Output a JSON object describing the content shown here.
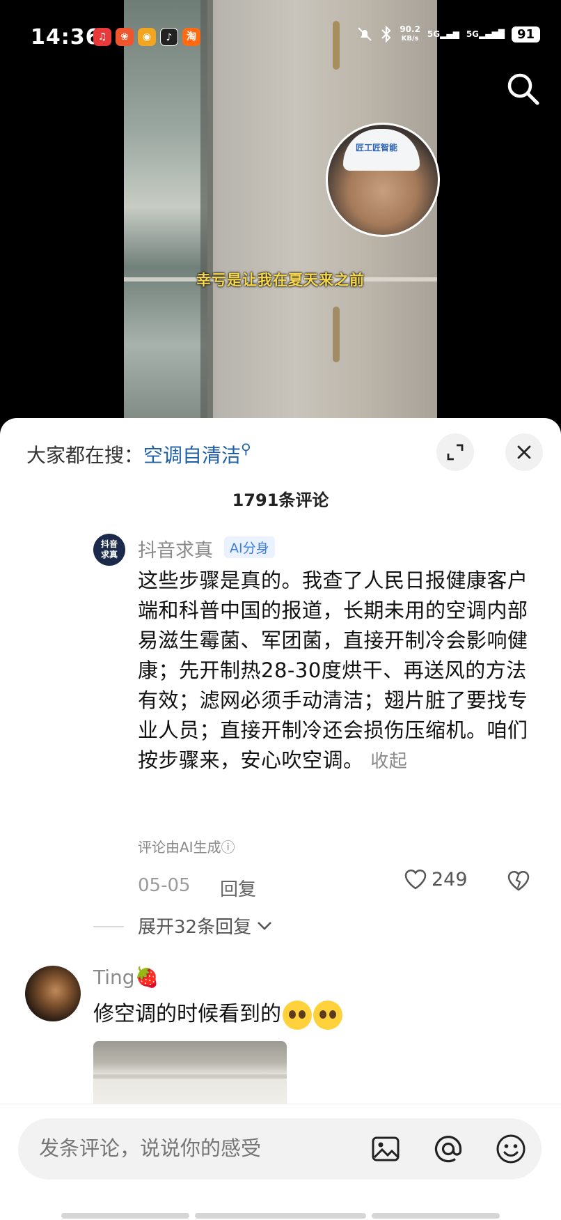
{
  "status_bar": {
    "time": "14:36",
    "network_speed": "90.2",
    "network_unit": "KB/s",
    "sig1": "5G",
    "sig2": "5G",
    "battery": "91"
  },
  "video": {
    "subtitle": "幸亏是让我在夏天来之前",
    "helmet_text": "匠工匠智能"
  },
  "header": {
    "hot_search_prefix": "大家都在搜：",
    "hot_search_keyword": "空调自清洁"
  },
  "comments_count": "1791条评论",
  "comments": [
    {
      "avatar_text": "抖音求真",
      "name": "抖音求真",
      "badge": "AI分身",
      "text": "这些步骤是真的。我查了人民日报健康客户端和科普中国的报道，长期未用的空调内部易滋生霉菌、军团菌，直接开制冷会影响健康；先开制热28-30度烘干、再送风的方法有效；滤网必须手动清洁；翅片脏了要找专业人员；直接开制冷还会损伤压缩机。咱们按步骤来，安心吹空调。",
      "collapse_label": "收起",
      "ai_note": "评论由AI生成ⓘ",
      "date": "05-05",
      "reply_label": "回复",
      "likes": "249",
      "expand_replies": "展开32条回复"
    },
    {
      "name": "Ting🍓",
      "text": "修空调的时候看到的"
    }
  ],
  "input": {
    "placeholder": "发条评论，说说你的感受"
  },
  "colors": {
    "accent_blue": "#1f5fa6",
    "subtitle_yellow": "#f7d84a",
    "ai_badge_bg": "#eaf2ff",
    "ai_badge_text": "#3d7ee0"
  }
}
